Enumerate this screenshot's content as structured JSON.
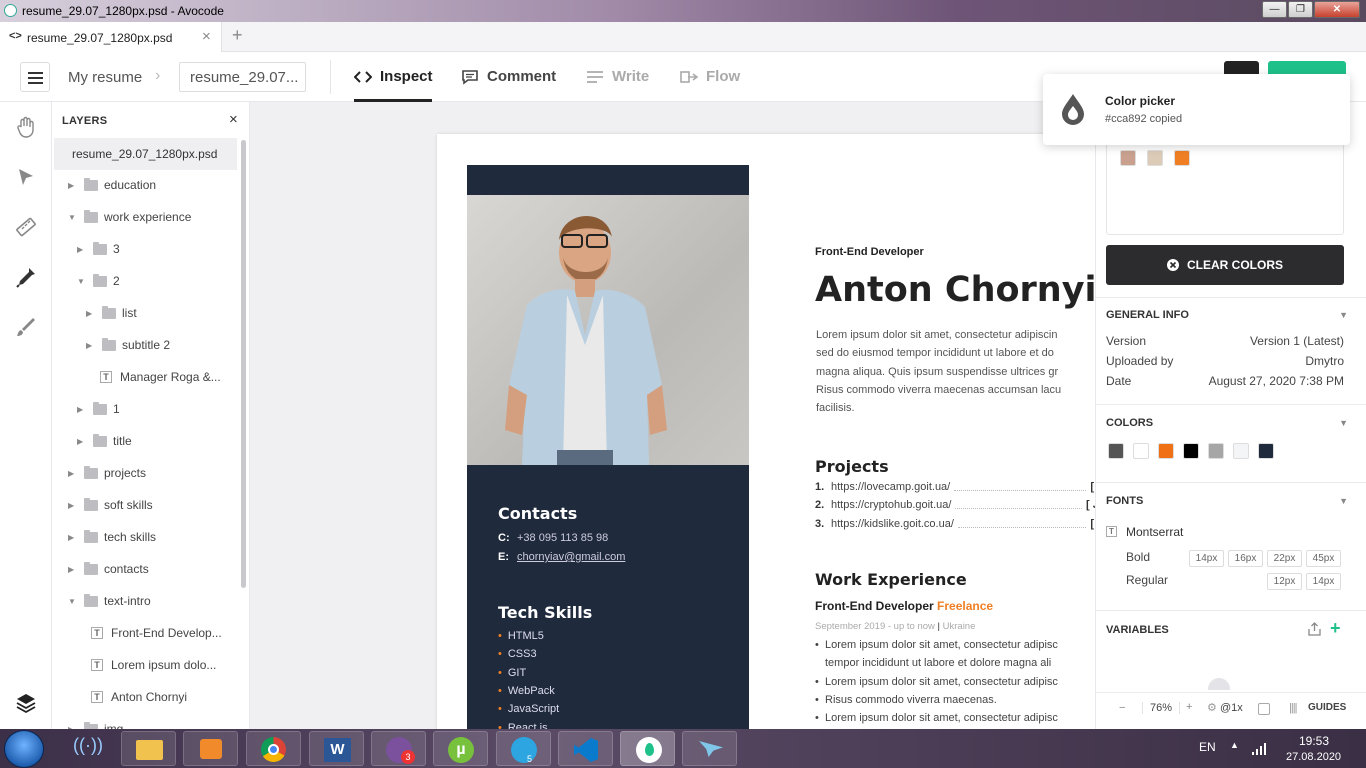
{
  "window": {
    "title": "resume_29.07_1280px.psd - Avocode",
    "min": "—",
    "max": "❐",
    "close": "✕"
  },
  "tab": {
    "label": "resume_29.07_1280px.psd",
    "code_icon": "<>",
    "close": "×",
    "add": "+"
  },
  "toolbar": {
    "breadcrumb": "My resume",
    "file": "resume_29.07...",
    "modes": [
      {
        "label": "Inspect",
        "icon": "code-icon"
      },
      {
        "label": "Comment",
        "icon": "comment-icon"
      },
      {
        "label": "Write",
        "icon": "write-icon"
      },
      {
        "label": "Flow",
        "icon": "flow-icon"
      }
    ]
  },
  "toast": {
    "title": "Color picker",
    "message": "#cca892 copied"
  },
  "layers": {
    "title": "LAYERS",
    "close": "×",
    "root": "resume_29.07_1280px.psd",
    "items": [
      {
        "label": "education",
        "type": "folder",
        "depth": 0,
        "open": false
      },
      {
        "label": "work experience",
        "type": "folder",
        "depth": 0,
        "open": true
      },
      {
        "label": "3",
        "type": "folder",
        "depth": 1,
        "open": false
      },
      {
        "label": "2",
        "type": "folder",
        "depth": 1,
        "open": true
      },
      {
        "label": "list",
        "type": "folder",
        "depth": 2,
        "open": false
      },
      {
        "label": "subtitle 2",
        "type": "folder",
        "depth": 2,
        "open": false
      },
      {
        "label": "Manager Roga &...",
        "type": "text",
        "depth": 2
      },
      {
        "label": "1",
        "type": "folder",
        "depth": 1,
        "open": false
      },
      {
        "label": "title",
        "type": "folder",
        "depth": 1,
        "open": false
      },
      {
        "label": "projects",
        "type": "folder",
        "depth": 0,
        "open": false
      },
      {
        "label": "soft skills",
        "type": "folder",
        "depth": 0,
        "open": false
      },
      {
        "label": "tech skills",
        "type": "folder",
        "depth": 0,
        "open": false
      },
      {
        "label": "contacts",
        "type": "folder",
        "depth": 0,
        "open": false
      },
      {
        "label": "text-intro",
        "type": "folder",
        "depth": 0,
        "open": true
      },
      {
        "label": "Front-End Develop...",
        "type": "text",
        "depth": 1
      },
      {
        "label": "Lorem ipsum dolo...",
        "type": "text",
        "depth": 1
      },
      {
        "label": "Anton Chornyi",
        "type": "text",
        "depth": 1
      },
      {
        "label": "img",
        "type": "folder",
        "depth": 0,
        "open": false
      }
    ]
  },
  "resume": {
    "role": "Front-End Developer",
    "name": "Anton Chornyi",
    "intro": [
      "Lorem ipsum dolor sit amet, consectetur adipiscin",
      "sed do eiusmod tempor incididunt ut labore et do",
      "magna aliqua. Quis ipsum suspendisse ultrices gr",
      "Risus commodo viverra maecenas accumsan lacu",
      "facilisis."
    ],
    "contacts_title": "Contacts",
    "phone_label": "C:",
    "phone": "+38 095 113 85 98",
    "email_label": "E:",
    "email": "chornyiav@gmail.com",
    "skills_title": "Tech Skills",
    "skills": [
      "HTML5",
      "CSS3",
      "GIT",
      "WebPack",
      "JavaScript",
      "React js"
    ],
    "projects_title": "Projects",
    "projects": [
      {
        "num": "1.",
        "url": "https://lovecamp.goit.ua/",
        "tail": "[ H"
      },
      {
        "num": "2.",
        "url": "https://cryptohub.goit.ua/",
        "tail": "[ Ja"
      },
      {
        "num": "3.",
        "url": "https://kidslike.goit.co.ua/",
        "tail": "[ R"
      }
    ],
    "work_title": "Work Experience",
    "job_title": "Front-End Developer",
    "job_company": "Freelance",
    "job_dates": "September 2019 - up to now",
    "job_sep": "|",
    "job_location": "Ukraine",
    "job_bullets": [
      "Lorem ipsum dolor sit amet, consectetur adipisc",
      "tempor incididunt ut labore et dolore magna ali",
      "Lorem ipsum dolor sit amet, consectetur adipisc",
      "Risus commodo viverra maecenas.",
      "Lorem ipsum dolor sit amet, consectetur adipisc"
    ]
  },
  "inspector": {
    "picked_colors": [
      "#c9a08e",
      "#dccbb7",
      "#f07f24"
    ],
    "clear_label": "CLEAR COLORS",
    "general_title": "GENERAL INFO",
    "info": [
      {
        "key": "Version",
        "value": "Version 1 (Latest)"
      },
      {
        "key": "Uploaded by",
        "value": "Dmytro"
      },
      {
        "key": "Date",
        "value": "August 27, 2020 7:38 PM"
      }
    ],
    "colors_title": "COLORS",
    "colors": [
      "#555555",
      "#ffffff",
      "#f07016",
      "#000000",
      "#a6a6a6",
      "#f4f5f7",
      "#1f2a3c"
    ],
    "fonts_title": "FONTS",
    "font_name": "Montserrat",
    "font_icon": "T",
    "bold_label": "Bold",
    "bold_sizes": [
      "14px",
      "16px",
      "22px",
      "45px"
    ],
    "regular_label": "Regular",
    "regular_sizes": [
      "12px",
      "14px"
    ],
    "variables_title": "VARIABLES",
    "zoom_minus": "−",
    "zoom": "76%",
    "zoom_plus": "+",
    "scale": "@1x",
    "guides": "GUIDES"
  },
  "taskbar": {
    "lang": "EN",
    "time": "19:53",
    "date": "27.08.2020",
    "viber_badge": "3",
    "telegram_badge": "5"
  }
}
